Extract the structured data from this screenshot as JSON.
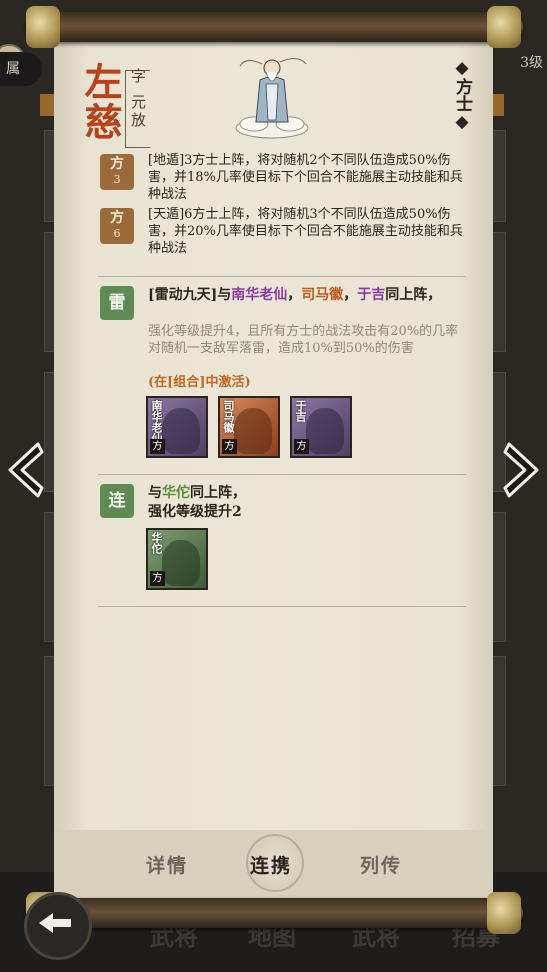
{
  "background": {
    "left_badge": "属",
    "right_badge": "3级",
    "bottom_tabs": [
      "武将",
      "地图",
      "武将",
      "招募"
    ]
  },
  "hero": {
    "name": "左慈",
    "courtesy": "字 元放",
    "class": "方士"
  },
  "skills": [
    {
      "badge": "方",
      "level": "3",
      "text": "[地遁]3方士上阵，将对随机2个不同队伍造成50%伤害，并18%几率使目标下个回合不能施展主动技能和兵种战法"
    },
    {
      "badge": "方",
      "level": "6",
      "text": "[天遁]6方士上阵，将对随机3个不同队伍造成50%伤害，并20%几率使目标下个回合不能施展主动技能和兵种战法"
    }
  ],
  "combos": [
    {
      "badge": "雷",
      "prefix": "[雷动九天]与",
      "partner1": "南华老仙",
      "sep1": "，",
      "partner2": "司马徽",
      "sep2": "，",
      "partner3": "于吉",
      "suffix": "同上阵，",
      "desc": "强化等级提升4，且所有方士的战法攻击有20%的几率对随机一支敌军落雷，造成10%到50%的伤害",
      "active": "(在[组合]中激活)",
      "portraits": [
        {
          "name": "南华老仙",
          "class": "方"
        },
        {
          "name": "司马徽",
          "class": "方"
        },
        {
          "name": "于吉",
          "class": "方"
        }
      ]
    },
    {
      "badge": "连",
      "prefix": "与",
      "partner1": "华佗",
      "suffix": "同上阵，",
      "desc2": "强化等级提升2",
      "portraits": [
        {
          "name": "华佗",
          "class": "方"
        }
      ]
    }
  ],
  "tabs": {
    "details": "详情",
    "bonds": "连携",
    "biography": "列传"
  },
  "colors": {
    "name_red": "#b8411c",
    "skill_brown": "#9a6a3a",
    "combo_green": "#5f8a52",
    "highlight_purple": "#8a3aa3",
    "highlight_orange": "#c25a1c",
    "highlight_green": "#5e8d3a"
  },
  "icons": [
    "back-arrow-icon",
    "left-arrow-icon",
    "right-arrow-icon"
  ]
}
